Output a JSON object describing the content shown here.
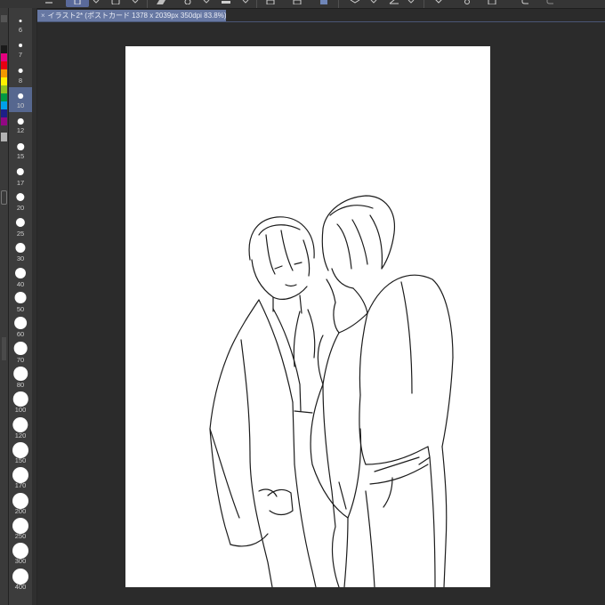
{
  "toolbar": {
    "buttons": [
      {
        "name": "menu-lines-icon"
      },
      {
        "name": "undo-history-icon"
      },
      {
        "name": "view-rotate-icon"
      },
      {
        "name": "layer-icon"
      },
      {
        "name": "selection-icon"
      },
      {
        "name": "ruler-icon"
      },
      {
        "name": "fill-icon"
      },
      {
        "name": "transform-icon"
      },
      {
        "name": "vector-icon"
      },
      {
        "name": "redo-icon"
      }
    ]
  },
  "palette": {
    "swatches": [
      "#1a1a1a",
      "#e4007f",
      "#e60012",
      "#f39800",
      "#fff100",
      "#8fc31f",
      "#009944",
      "#00a0e9",
      "#1d2088",
      "#920783",
      "#b3b3b3"
    ]
  },
  "brush_sizes": {
    "selected": "10",
    "items": [
      "6",
      "7",
      "8",
      "10",
      "12",
      "15",
      "17",
      "20",
      "25",
      "30",
      "40",
      "50",
      "60",
      "70",
      "80",
      "100",
      "120",
      "150",
      "170",
      "200",
      "250",
      "300",
      "400"
    ]
  },
  "document": {
    "tab_title": "イラスト2* (ポストカード 1378 x 2039px 350dpi 83.8%)",
    "close_glyph": "×"
  },
  "colors": {
    "app_background": "#2b2b2b",
    "panel": "#3c3c3c",
    "accent": "#6778a3",
    "canvas": "#ffffff",
    "line_art": "#1c1c1c"
  }
}
